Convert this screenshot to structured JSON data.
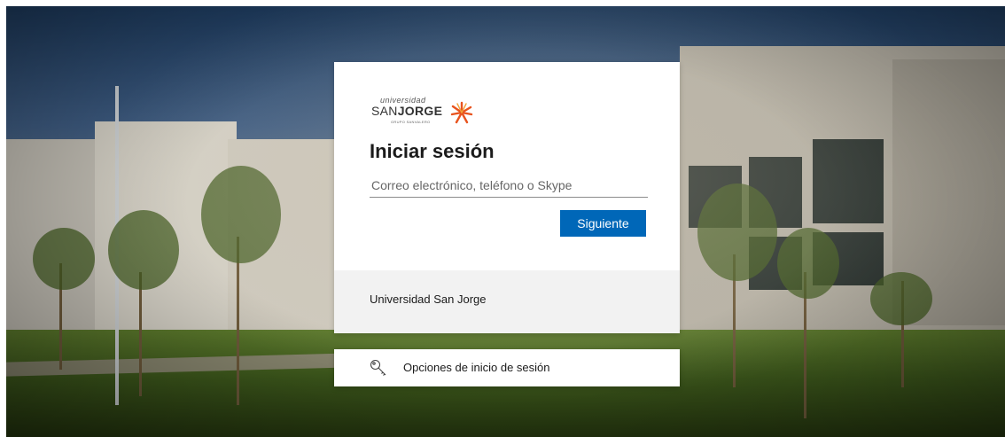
{
  "brand": {
    "logo_top": "universidad",
    "logo_san": "SAN",
    "logo_jorge": "JORGE",
    "logo_group": "GRUPO SANVALERO",
    "accent": "#e8531e"
  },
  "signin": {
    "title": "Iniciar sesión",
    "email_placeholder": "Correo electrónico, teléfono o Skype",
    "email_value": "",
    "next_label": "Siguiente",
    "button_color": "#0067b8"
  },
  "footer": {
    "org_name": "Universidad San Jorge"
  },
  "options": {
    "label": "Opciones de inicio de sesión",
    "icon": "key-icon"
  }
}
